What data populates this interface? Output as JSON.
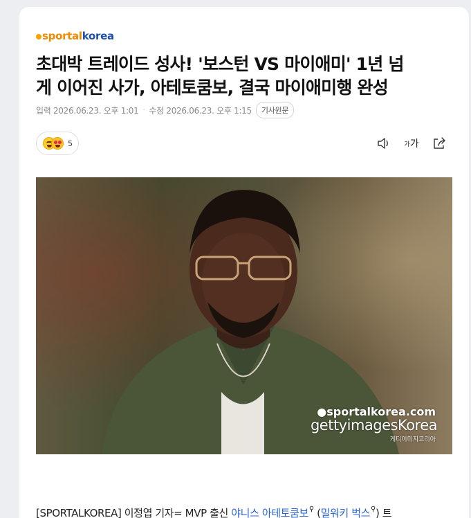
{
  "site": {
    "logo_part1": "sportal",
    "logo_part2": "korea"
  },
  "article": {
    "headline_line1": "초대박 트레이드 성사! '보스턴 VS 마이애미' 1년 넘",
    "headline_line2": "게 이어진 사가, 아테토쿰보, 결국 마이애미행 완성",
    "published_label": "입력",
    "published_time": "2026.06.23. 오후 1:01",
    "modified_label": "수정",
    "modified_time": "2026.06.23. 오후 1:15",
    "original_button": "기사원문"
  },
  "reactions": {
    "count": "5"
  },
  "toolbar": {
    "audio_icon": "speaker-icon",
    "fontsize_small": "가",
    "fontsize_big": "가",
    "share_icon": "share-icon"
  },
  "photo": {
    "watermark1": "●sportalkorea.com",
    "watermark2": "gettyimagesKorea",
    "watermark3": "게티이미지코리아"
  },
  "body": {
    "prefix": "[SPORTALKOREA] 이정엽 기자= MVP 출신 ",
    "link1": "야니스 아테토쿰보",
    "mid": " (",
    "link2": "밀워키 벅스",
    "suffix": ") 트"
  },
  "colors": {
    "accent_orange": "#f08a00",
    "accent_blue": "#1f4fa8",
    "link": "#2b63d8"
  }
}
